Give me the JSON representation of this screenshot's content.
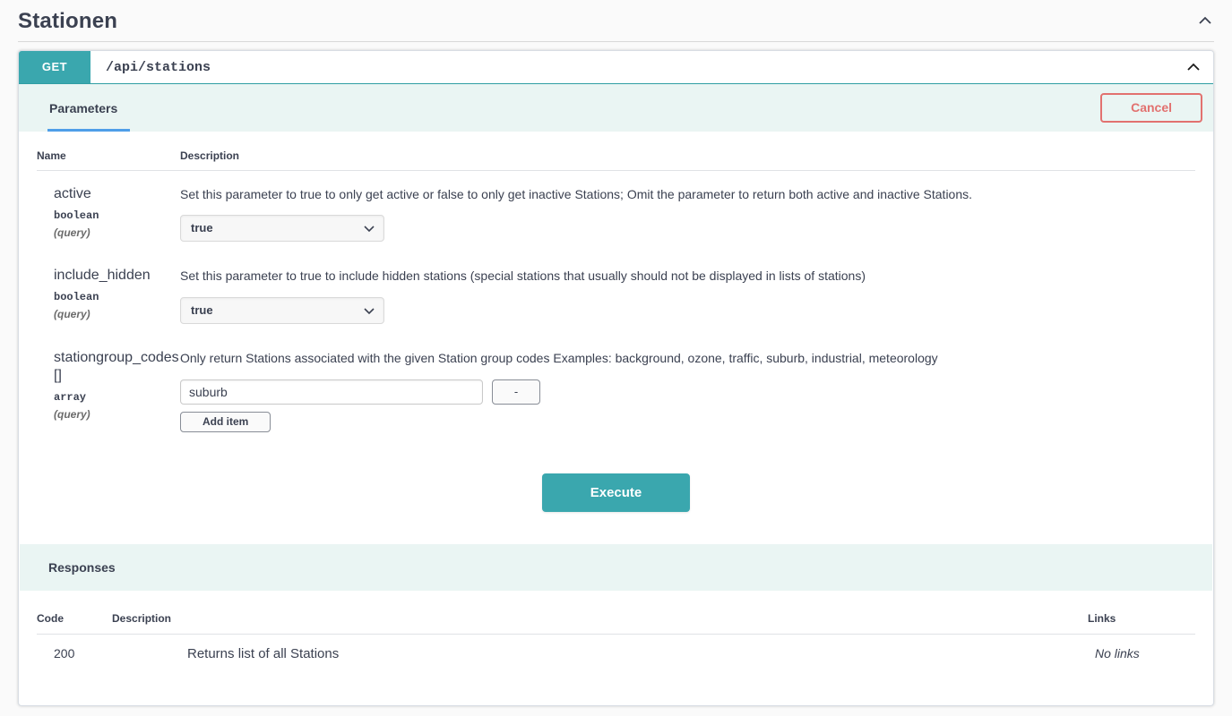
{
  "tag": {
    "title": "Stationen",
    "collapse_icon": "chevron-up-icon"
  },
  "operation": {
    "method": "GET",
    "path": "/api/stations",
    "collapse_icon": "chevron-up-icon"
  },
  "parameters_band": {
    "tab_label": "Parameters",
    "cancel_label": "Cancel"
  },
  "parameters_table": {
    "headers": {
      "name": "Name",
      "description": "Description"
    },
    "rows": [
      {
        "name": "active",
        "type": "boolean",
        "in": "(query)",
        "description": "Set this parameter to true to only get active or false to only get inactive Stations; Omit the parameter to return both active and inactive Stations.",
        "control": "select",
        "value": "true",
        "arrow_icon": "chevron-down-icon"
      },
      {
        "name": "include_hidden",
        "type": "boolean",
        "in": "(query)",
        "description": "Set this parameter to true to include hidden stations (special stations that usually should not be displayed in lists of stations)",
        "control": "select",
        "value": "true",
        "arrow_icon": "chevron-down-icon"
      },
      {
        "name": "stationgroup_codes[]",
        "type": "array",
        "in": "(query)",
        "description": "Only return Stations associated with the given Station group codes Examples: background, ozone, traffic, suburb, industrial, meteorology",
        "control": "array",
        "value": "suburb",
        "placeholder": "",
        "remove_label": "-",
        "add_label": "Add item"
      }
    ]
  },
  "execute": {
    "label": "Execute"
  },
  "responses": {
    "title": "Responses",
    "headers": {
      "code": "Code",
      "description": "Description",
      "links": "Links"
    },
    "rows": [
      {
        "code": "200",
        "description": "Returns list of all Stations",
        "links": "No links"
      }
    ]
  },
  "colors": {
    "accent_teal": "#3aa7ae",
    "band_bg": "#eaf5f3",
    "cancel_red": "#e2716f",
    "tab_underline": "#4f9ee8",
    "page_bg": "#fafafa"
  }
}
